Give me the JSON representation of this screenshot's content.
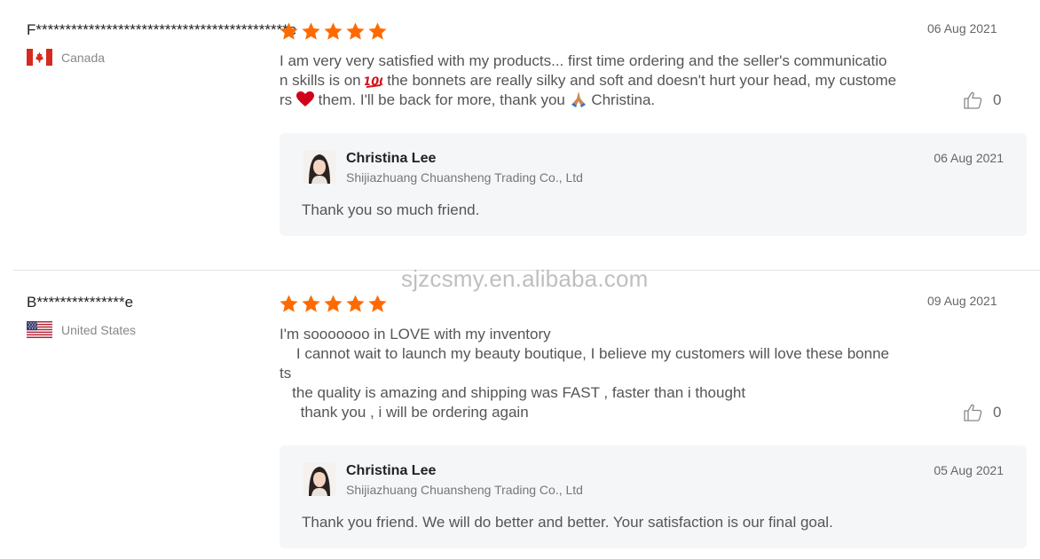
{
  "colors": {
    "star": "#ff6a00",
    "reply_bg": "#f5f6f8",
    "divider": "#e3e3e3"
  },
  "watermark": "sjzcsmy.en.alibaba.com",
  "reviews": [
    {
      "buyer": "F*******************************************e",
      "country": "Canada",
      "flag_icon": "canada-flag-icon",
      "rating": 5,
      "date": "06 Aug 2021",
      "text_lines": [
        "I am very very satisfied with my products... first time ordering and the seller's communicatio",
        "n skills is on",
        "the bonnets are really silky and soft and doesn't hurt your head, my custome",
        "rs",
        "them. I'll be back for more, thank you",
        "Christina."
      ],
      "likes": "0",
      "reply": {
        "seller": "Christina Lee",
        "company": "Shijiazhuang Chuansheng Trading Co., Ltd",
        "date": "06 Aug 2021",
        "text": "Thank you so much friend."
      }
    },
    {
      "buyer": "B***************e",
      "country": "United States",
      "flag_icon": "us-flag-icon",
      "rating": 5,
      "date": "09 Aug 2021",
      "text_lines": [
        "I'm sooooooo in LOVE with my inventory",
        "    I cannot wait to launch my beauty boutique, I believe my customers will love these bonne",
        "ts",
        "   the quality is amazing and shipping was FAST , faster than i thought",
        "     thank you , i will be ordering again"
      ],
      "likes": "0",
      "reply": {
        "seller": "Christina Lee",
        "company": "Shijiazhuang Chuansheng Trading Co., Ltd",
        "date": "05 Aug 2021",
        "text": "Thank you friend. We will do better and better. Your satisfaction is our final goal."
      }
    }
  ]
}
